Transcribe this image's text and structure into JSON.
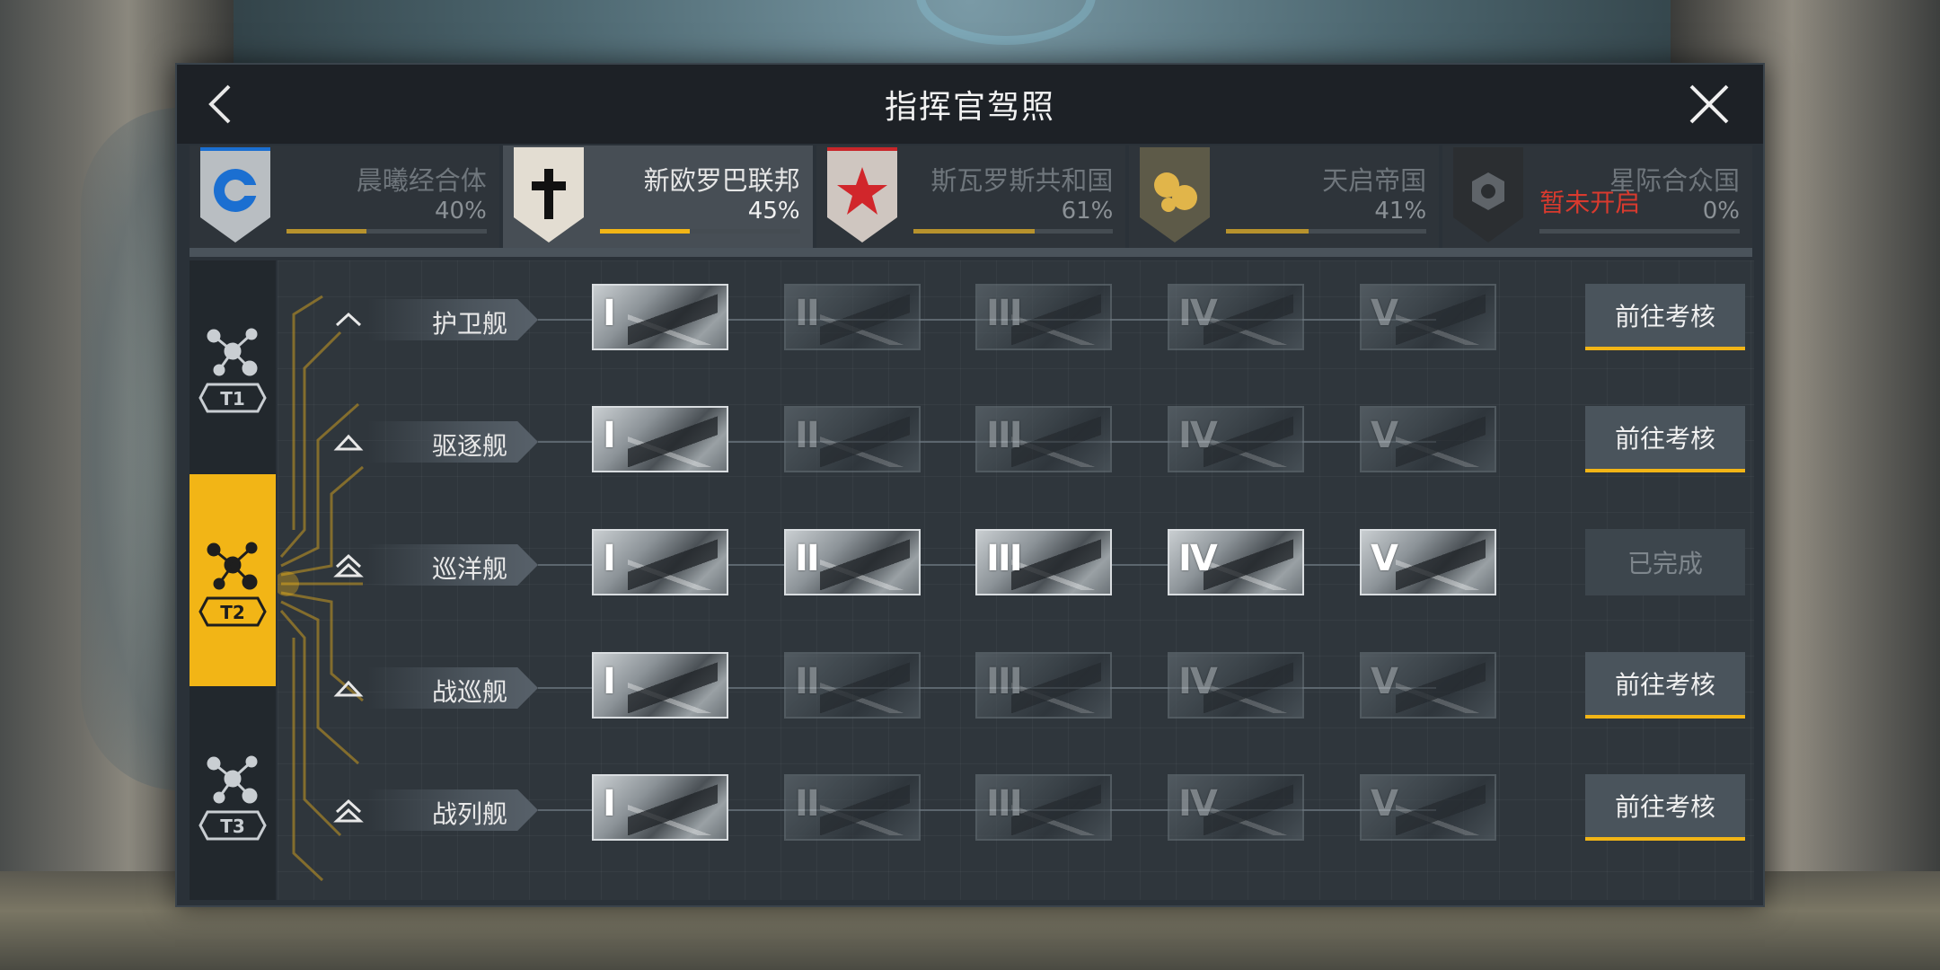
{
  "title": "指挥官驾照",
  "icons": {
    "back": "chevron-left-icon",
    "close": "close-icon"
  },
  "colors": {
    "accent": "#f2b516",
    "locked_text": "#d93a2e",
    "panel": "#2a3138"
  },
  "factions": [
    {
      "name": "晨曦经合体",
      "percent": "40%",
      "progress": 0.4,
      "emblem": "blue-ring-emblem",
      "active": false,
      "locked": false,
      "locked_label": ""
    },
    {
      "name": "新欧罗巴联邦",
      "percent": "45%",
      "progress": 0.45,
      "emblem": "black-cross-emblem",
      "active": true,
      "locked": false,
      "locked_label": ""
    },
    {
      "name": "斯瓦罗斯共和国",
      "percent": "61%",
      "progress": 0.61,
      "emblem": "red-star-emblem",
      "active": false,
      "locked": false,
      "locked_label": ""
    },
    {
      "name": "天启帝国",
      "percent": "41%",
      "progress": 0.41,
      "emblem": "gold-circles-emblem",
      "active": false,
      "locked": false,
      "locked_label": ""
    },
    {
      "name": "星际合众国",
      "percent": "0%",
      "progress": 0.0,
      "emblem": "dark-hexagon-emblem",
      "active": false,
      "locked": true,
      "locked_label": "暂未开启"
    }
  ],
  "tiers": [
    {
      "label": "T1",
      "active": false
    },
    {
      "label": "T2",
      "active": true
    },
    {
      "label": "T3",
      "active": false
    }
  ],
  "ship_classes": [
    {
      "name": "护卫舰",
      "chevron": "single-chevron-up-icon",
      "unlocked_levels": 1,
      "action": "前往考核",
      "completed": false
    },
    {
      "name": "驱逐舰",
      "chevron": "outline-chevron-up-icon",
      "unlocked_levels": 1,
      "action": "前往考核",
      "completed": false
    },
    {
      "name": "巡洋舰",
      "chevron": "double-chevron-up-icon",
      "unlocked_levels": 5,
      "action": "已完成",
      "completed": true
    },
    {
      "name": "战巡舰",
      "chevron": "outline-chevron-up-icon",
      "unlocked_levels": 1,
      "action": "前往考核",
      "completed": false
    },
    {
      "name": "战列舰",
      "chevron": "double-chevron-up-icon",
      "unlocked_levels": 1,
      "action": "前往考核",
      "completed": false
    }
  ],
  "levels": [
    "I",
    "II",
    "III",
    "IV",
    "V"
  ]
}
